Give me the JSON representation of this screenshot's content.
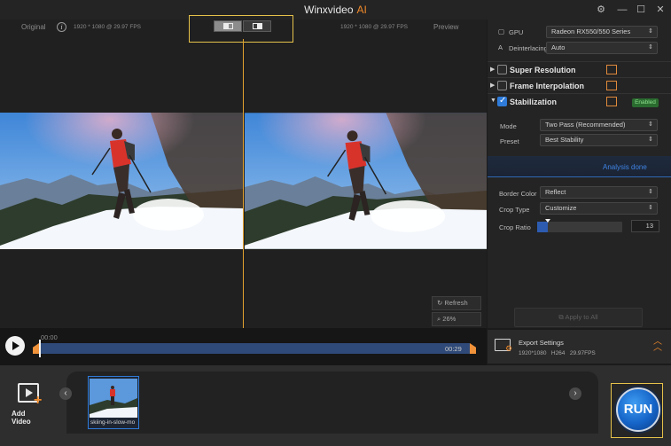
{
  "window": {
    "title": "Winxvideo",
    "title_ai": "AI"
  },
  "preview": {
    "original_label": "Original",
    "preview_label": "Preview",
    "original_info": "1920 * 1080 @ 29.97 FPS",
    "preview_info": "1920 * 1080 @ 29.97 FPS",
    "refresh_label": "Refresh",
    "zoom_label": "26%"
  },
  "timeline": {
    "current": "00:00",
    "end": "00:29"
  },
  "panel": {
    "gpu_label": "GPU",
    "gpu_value": "Radeon RX550/550 Series",
    "deinterlacing_label": "Deinterlacing",
    "deinterlacing_value": "Auto",
    "features": [
      {
        "name": "Super Resolution",
        "checked": false
      },
      {
        "name": "Frame Interpolation",
        "checked": false
      },
      {
        "name": "Stabilization",
        "checked": true
      }
    ],
    "enabled_badge": "Enabled",
    "mode_label": "Mode",
    "mode_value": "Two Pass (Recommended)",
    "preset_label": "Preset",
    "preset_value": "Best Stability",
    "analysis_status": "Analysis done",
    "border_color_label": "Border Color",
    "border_color_value": "Reflect",
    "crop_type_label": "Crop Type",
    "crop_type_value": "Customize",
    "crop_ratio_label": "Crop Ratio",
    "crop_ratio_value": "13",
    "apply_all_label": "Apply to All"
  },
  "export": {
    "title": "Export Settings",
    "resolution": "1920*1080",
    "codec": "H264",
    "fps": "29.97FPS"
  },
  "bottom": {
    "add_video_label": "Add Video",
    "thumbnail_name": "skiing-in-slow-mo",
    "run_label": "RUN"
  },
  "colors": {
    "accent": "#f08a2a",
    "highlight_box": "#e6c24a",
    "timeline_track": "#2f4a78",
    "run_button": "#1564c8",
    "link_blue": "#3f84e5"
  }
}
